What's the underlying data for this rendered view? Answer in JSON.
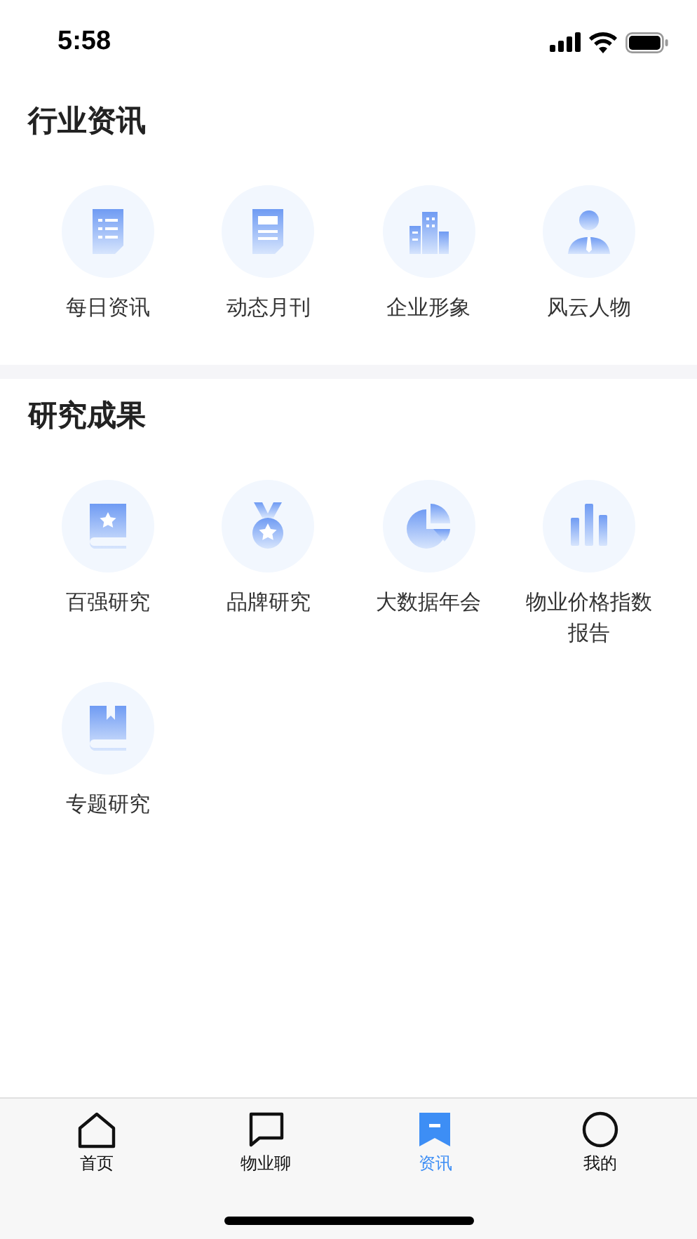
{
  "status_bar": {
    "time": "5:58"
  },
  "sections": [
    {
      "title": "行业资讯",
      "items": [
        {
          "label": "每日资讯",
          "kind": "list"
        },
        {
          "label": "动态月刊",
          "kind": "document"
        },
        {
          "label": "企业形象",
          "kind": "buildings"
        },
        {
          "label": "风云人物",
          "kind": "person"
        }
      ]
    },
    {
      "title": "研究成果",
      "items": [
        {
          "label": "百强研究",
          "kind": "book-star"
        },
        {
          "label": "品牌研究",
          "kind": "medal"
        },
        {
          "label": "大数据年会",
          "kind": "pie"
        },
        {
          "label": "物业价格指数报告",
          "kind": "bars"
        },
        {
          "label": "专题研究",
          "kind": "book-bookmark"
        }
      ]
    }
  ],
  "tab_bar": [
    {
      "label": "首页",
      "kind": "home",
      "selected": false
    },
    {
      "label": "物业聊",
      "kind": "chat",
      "selected": false
    },
    {
      "label": "资讯",
      "kind": "news",
      "selected": true
    },
    {
      "label": "我的",
      "kind": "profile",
      "selected": false
    }
  ]
}
